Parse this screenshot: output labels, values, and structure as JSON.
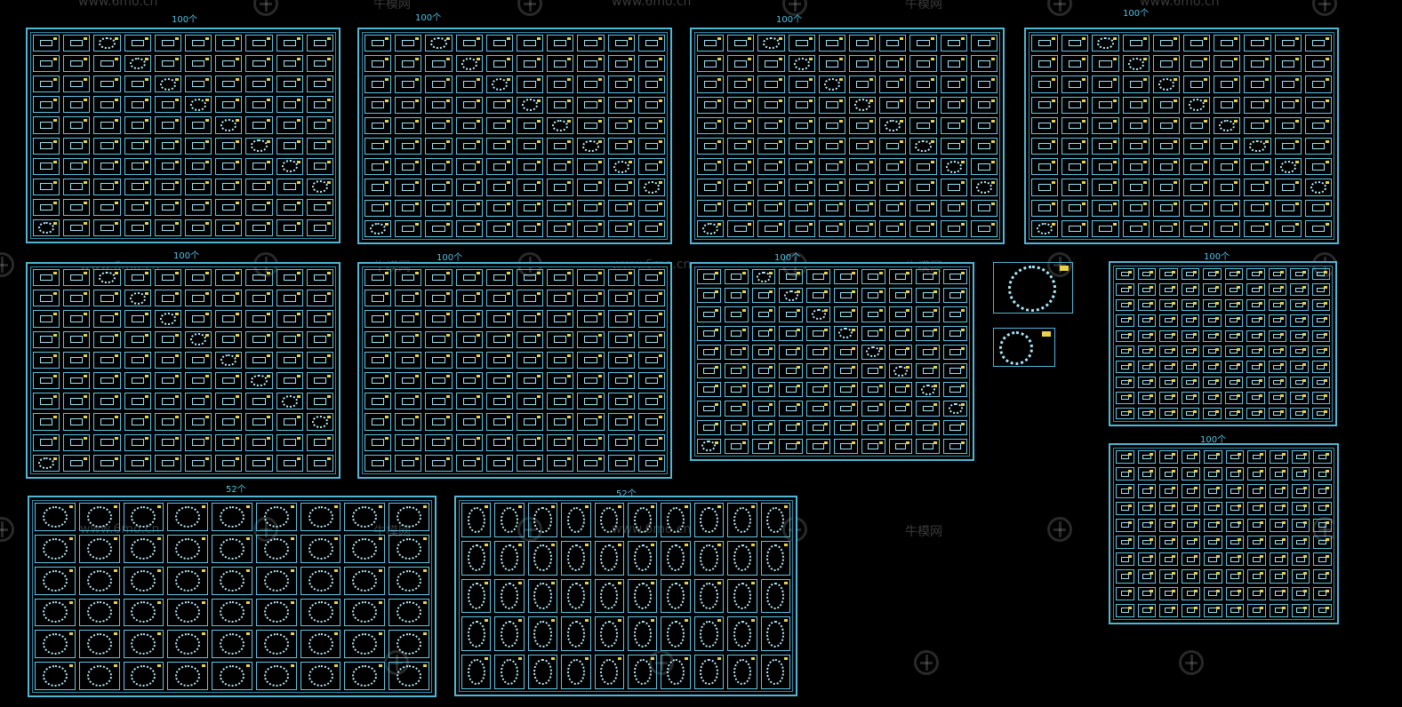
{
  "canvas": {
    "background": "#000000",
    "line_color": "#4fb6d6",
    "accent_color": "#e8d24a"
  },
  "labels": {
    "p1": "100个",
    "p2": "100个",
    "p3": "100个",
    "p4": "100个",
    "p5": "100个",
    "p6": "100个",
    "p7": "100个",
    "p8": "100个",
    "p9": "100个",
    "p10": "52个",
    "p11": "52个"
  },
  "watermarks": {
    "site": "www.6mo.cn",
    "brand": "牛模网"
  }
}
